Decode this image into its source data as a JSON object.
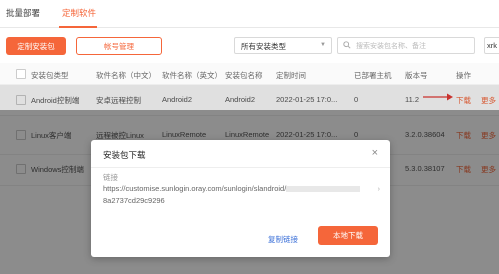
{
  "tabs": [
    {
      "label": "批量部署"
    },
    {
      "label": "定制软件"
    }
  ],
  "toolbar": {
    "custom_package_button": "定制安装包",
    "account_manage_button": "帐号管理",
    "type_select_value": "所有安装类型",
    "search_placeholder": "搜索安装包名称、备注",
    "right_cut_text": "xrk"
  },
  "table": {
    "headers": [
      "安装包类型",
      "软件名称（中文）",
      "软件名称（英文）",
      "安装包名称",
      "定制时间",
      "已部署主机",
      "版本号",
      "操作"
    ],
    "rows": [
      {
        "type": "Android控制端",
        "name_cn": "安卓远程控制",
        "name_en": "Android2",
        "package": "Android2",
        "time": "2022-01-25 17:0...",
        "deployed": "0",
        "version": "11.2",
        "action_download": "下载",
        "action_more": "更多"
      },
      {
        "type": "Linux客户端",
        "name_cn": "远程被控Linux",
        "name_en": "LinuxRemote",
        "package": "LinuxRemote",
        "time": "2022-01-25 17:0...",
        "deployed": "0",
        "version": "3.2.0.38604",
        "action_download": "下载",
        "action_more": "更多"
      },
      {
        "type": "Windows控制端",
        "name_cn": "",
        "name_en": "",
        "package": "",
        "time": "",
        "deployed": "",
        "version": "5.3.0.38107",
        "action_download": "下载",
        "action_more": "更多"
      }
    ]
  },
  "modal": {
    "title": "安装包下载",
    "link_label": "链接",
    "url_line1": "https://customise.sunlogin.oray.com/sunlogin/slandroid/",
    "url_line2": "8a2737cd29c9296",
    "copy_link_button": "复制链接",
    "local_download_button": "本地下载"
  },
  "colors": {
    "accent": "#f5663a",
    "link_blue": "#3a6fd8"
  }
}
